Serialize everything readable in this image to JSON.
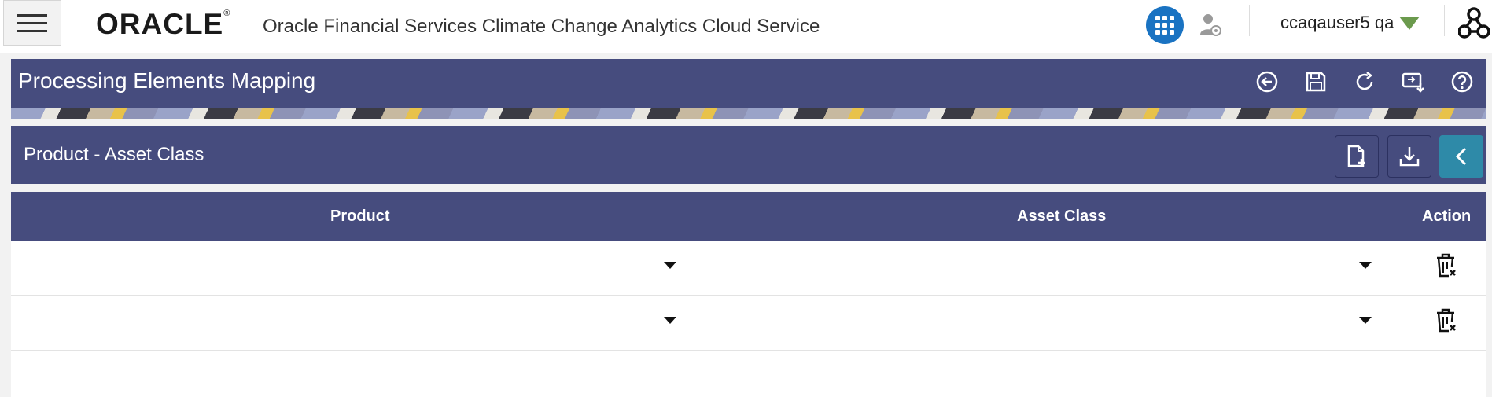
{
  "header": {
    "menu_icon": "hamburger-icon",
    "logo_text": "ORACLE",
    "logo_mark": "®",
    "app_title": "Oracle Financial Services Climate Change Analytics Cloud Service",
    "apps_icon": "grid-icon",
    "user_settings_icon": "user-settings-icon",
    "user_name": "ccaqauser5 qa",
    "hierarchy_icon": "hierarchy-icon",
    "accent_color": "#1a73c2"
  },
  "page": {
    "title": "Processing Elements Mapping",
    "actions": [
      "back-icon",
      "save-icon",
      "refresh-icon",
      "export-icon",
      "help-icon"
    ],
    "header_color": "#464c7e"
  },
  "section": {
    "title": "Product - Asset Class",
    "buttons": [
      "new-document-icon",
      "download-icon",
      "collapse-chevron-icon"
    ],
    "collapse_color": "#2e8aa8"
  },
  "table": {
    "columns": [
      "Product",
      "Asset Class",
      "Action"
    ],
    "rows": [
      {
        "product": "",
        "asset_class": ""
      },
      {
        "product": "",
        "asset_class": ""
      }
    ]
  }
}
